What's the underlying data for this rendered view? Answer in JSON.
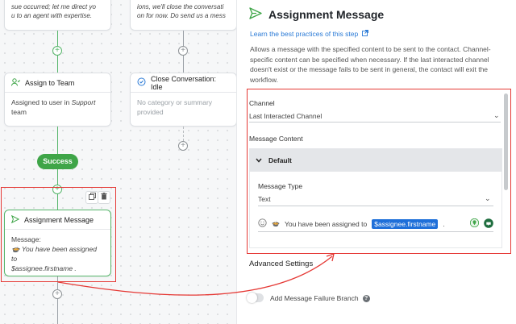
{
  "canvas": {
    "top_left_fragment": [
      "sue occurred; let me direct yo",
      "u to an agent with expertise."
    ],
    "top_right_fragment": [
      "ions, we'll close the conversati",
      "on for now. Do send us a mess"
    ],
    "assign_team": {
      "title": "Assign to Team",
      "body_prefix": "Assigned to user in ",
      "body_team": "Support",
      "body_suffix": "team"
    },
    "close_conv": {
      "title": "Close Conversation: Idle",
      "body": "No category or summary provided"
    },
    "success_label": "Success",
    "assignment_node": {
      "title": "Assignment Message",
      "label": "Message:",
      "text_line1": "You have been assigned to",
      "text_line2": "$assignee.firstname ."
    }
  },
  "panel": {
    "title": "Assignment Message",
    "learn_link": "Learn the best practices of this step",
    "description": "Allows a message with the specified content to be sent to the contact. Channel-specific content can be specified when necessary. If the last interacted channel doesn't exist or the message fails to be sent in general, the contact will exit the workflow.",
    "channel_label": "Channel",
    "channel_value": "Last Interacted Channel",
    "message_content_label": "Message Content",
    "default_label": "Default",
    "message_type_label": "Message Type",
    "message_type_value": "Text",
    "message_text": "You have been assigned to",
    "message_variable": "$assignee.firstname",
    "message_end": ".",
    "advanced_settings": "Advanced Settings",
    "failure_branch_label": "Add Message Failure Branch"
  },
  "colors": {
    "accent_green": "#3fa548",
    "highlight_red": "#e53935",
    "link_blue": "#2a7ad6",
    "variable_blue": "#1e6fd9"
  }
}
